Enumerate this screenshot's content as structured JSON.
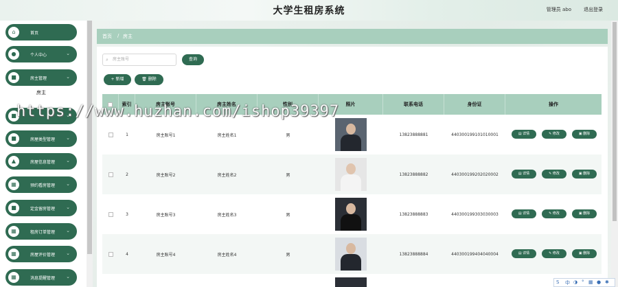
{
  "header": {
    "title": "大学生租房系统",
    "user": "管理员 abo",
    "logout": "退出登录"
  },
  "sidebar": {
    "items": [
      {
        "label": "首页",
        "icon": "home-icon",
        "has_arrow": false
      },
      {
        "label": "个人中心",
        "icon": "user-icon",
        "has_arrow": true
      },
      {
        "label": "房主管理",
        "icon": "list-icon",
        "has_arrow": true
      },
      {
        "label": "",
        "icon": "list-icon",
        "has_arrow": true
      },
      {
        "label": "房屋类型管理",
        "icon": "list-icon",
        "has_arrow": true
      },
      {
        "label": "房屋信息管理",
        "icon": "house-icon",
        "has_arrow": true
      },
      {
        "label": "预约看房管理",
        "icon": "grid-icon",
        "has_arrow": true
      },
      {
        "label": "定金留房管理",
        "icon": "list-icon",
        "has_arrow": true
      },
      {
        "label": "租房订单管理",
        "icon": "grid-icon",
        "has_arrow": true
      },
      {
        "label": "房屋评价管理",
        "icon": "grid-icon",
        "has_arrow": true
      },
      {
        "label": "消息提醒管理",
        "icon": "grid-icon",
        "has_arrow": true
      }
    ],
    "active_sub": "房主"
  },
  "breadcrumb": {
    "home": "首页",
    "sep": "/",
    "current": "房主"
  },
  "search": {
    "placeholder": "房主账号",
    "button": "查询"
  },
  "toolbar": {
    "add": "+ 新增",
    "delete": "删除"
  },
  "table": {
    "headers": [
      "",
      "索引",
      "房主账号",
      "房主姓名",
      "性别",
      "照片",
      "联系电话",
      "身份证",
      "操作"
    ],
    "rows": [
      {
        "index": "1",
        "account": "房主账号1",
        "name": "房主姓名1",
        "gender": "男",
        "phone": "13823888881",
        "id": "440300199101010001"
      },
      {
        "index": "2",
        "account": "房主账号2",
        "name": "房主姓名2",
        "gender": "男",
        "phone": "13823888882",
        "id": "440300199202020002"
      },
      {
        "index": "3",
        "account": "房主账号3",
        "name": "房主姓名3",
        "gender": "男",
        "phone": "13823888883",
        "id": "440300199303030003"
      },
      {
        "index": "4",
        "account": "房主账号4",
        "name": "房主姓名4",
        "gender": "男",
        "phone": "13823888884",
        "id": "440300199404040004"
      }
    ],
    "actions": {
      "detail": "详情",
      "edit": "修改",
      "delete": "删除"
    }
  },
  "watermark": "https://www.huzhan.com/ishop39397",
  "colors": {
    "primary": "#2f6b52",
    "header_row": "#a8cfbd"
  }
}
